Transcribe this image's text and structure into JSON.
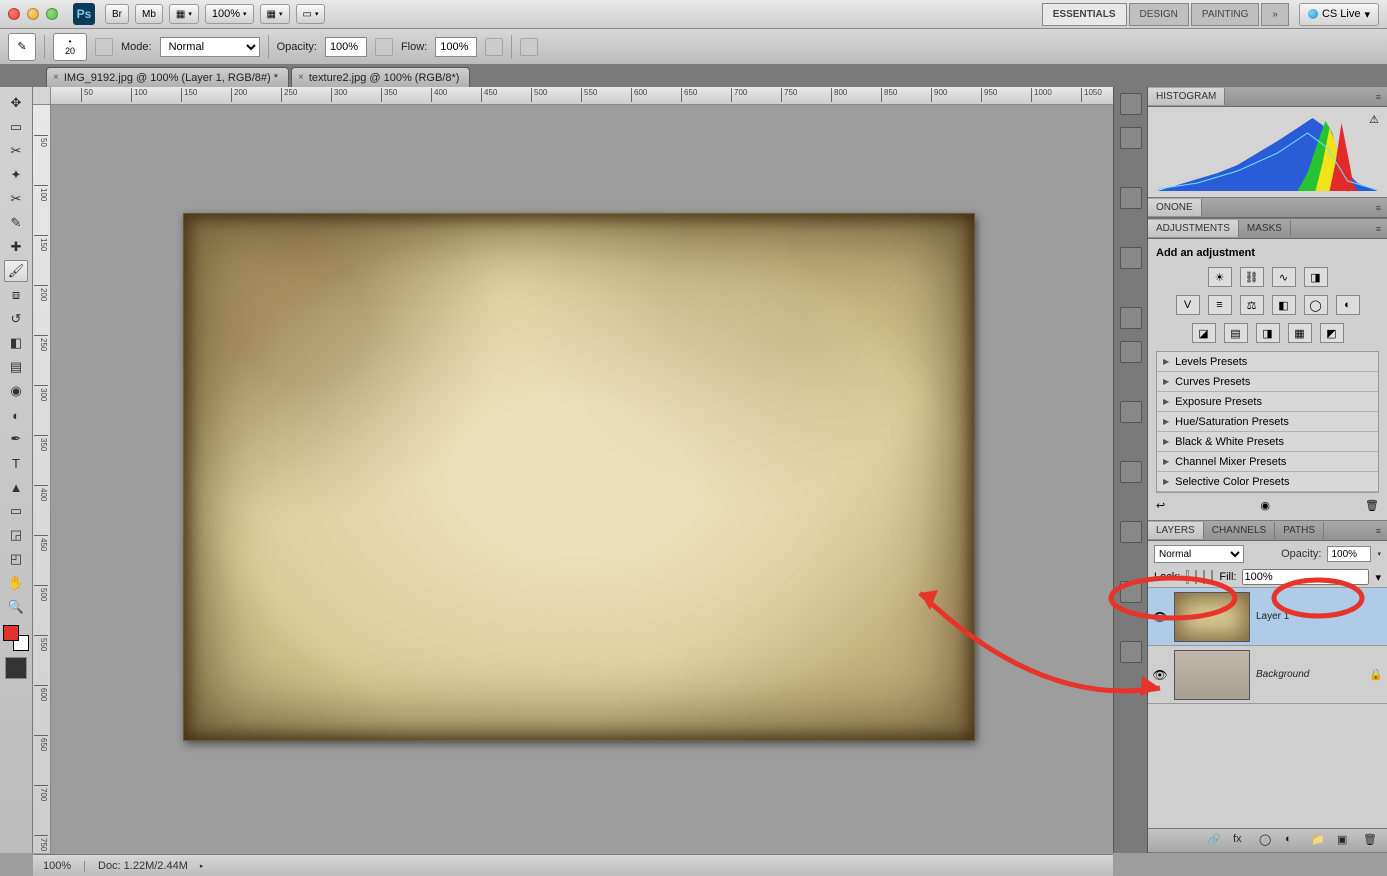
{
  "titlebar": {
    "zoom": "100%",
    "workspaces": [
      "ESSENTIALS",
      "DESIGN",
      "PAINTING"
    ],
    "cslive": "CS Live"
  },
  "optbar": {
    "brush_size": "20",
    "mode_label": "Mode:",
    "mode": "Normal",
    "opacity_label": "Opacity:",
    "opacity": "100%",
    "flow_label": "Flow:",
    "flow": "100%"
  },
  "doctabs": [
    "IMG_9192.jpg @ 100% (Layer 1, RGB/8#) *",
    "texture2.jpg @ 100% (RGB/8*)"
  ],
  "ruler_h": [
    "50",
    "100",
    "150",
    "200",
    "250",
    "300",
    "350",
    "400",
    "450",
    "500",
    "550",
    "600",
    "650",
    "700",
    "750",
    "800",
    "850",
    "900",
    "950",
    "1000",
    "1050"
  ],
  "ruler_v": [
    "50",
    "100",
    "150",
    "200",
    "250",
    "300",
    "350",
    "400",
    "450",
    "500",
    "550",
    "600",
    "650",
    "700",
    "750"
  ],
  "panels": {
    "histogram": "HISTOGRAM",
    "onone": "ONONE",
    "adjustments": "ADJUSTMENTS",
    "masks": "MASKS",
    "add_adj": "Add an adjustment",
    "presets": [
      "Levels Presets",
      "Curves Presets",
      "Exposure Presets",
      "Hue/Saturation Presets",
      "Black & White Presets",
      "Channel Mixer Presets",
      "Selective Color Presets"
    ]
  },
  "layers": {
    "tabs": [
      "LAYERS",
      "CHANNELS",
      "PATHS"
    ],
    "blend": "Normal",
    "opacity_label": "Opacity:",
    "opacity": "100%",
    "lock_label": "Lock:",
    "fill_label": "Fill:",
    "fill": "100%",
    "items": [
      {
        "name": "Layer 1",
        "locked": false
      },
      {
        "name": "Background",
        "locked": true
      }
    ]
  },
  "status": {
    "zoom": "100%",
    "doc": "Doc: 1.22M/2.44M"
  }
}
